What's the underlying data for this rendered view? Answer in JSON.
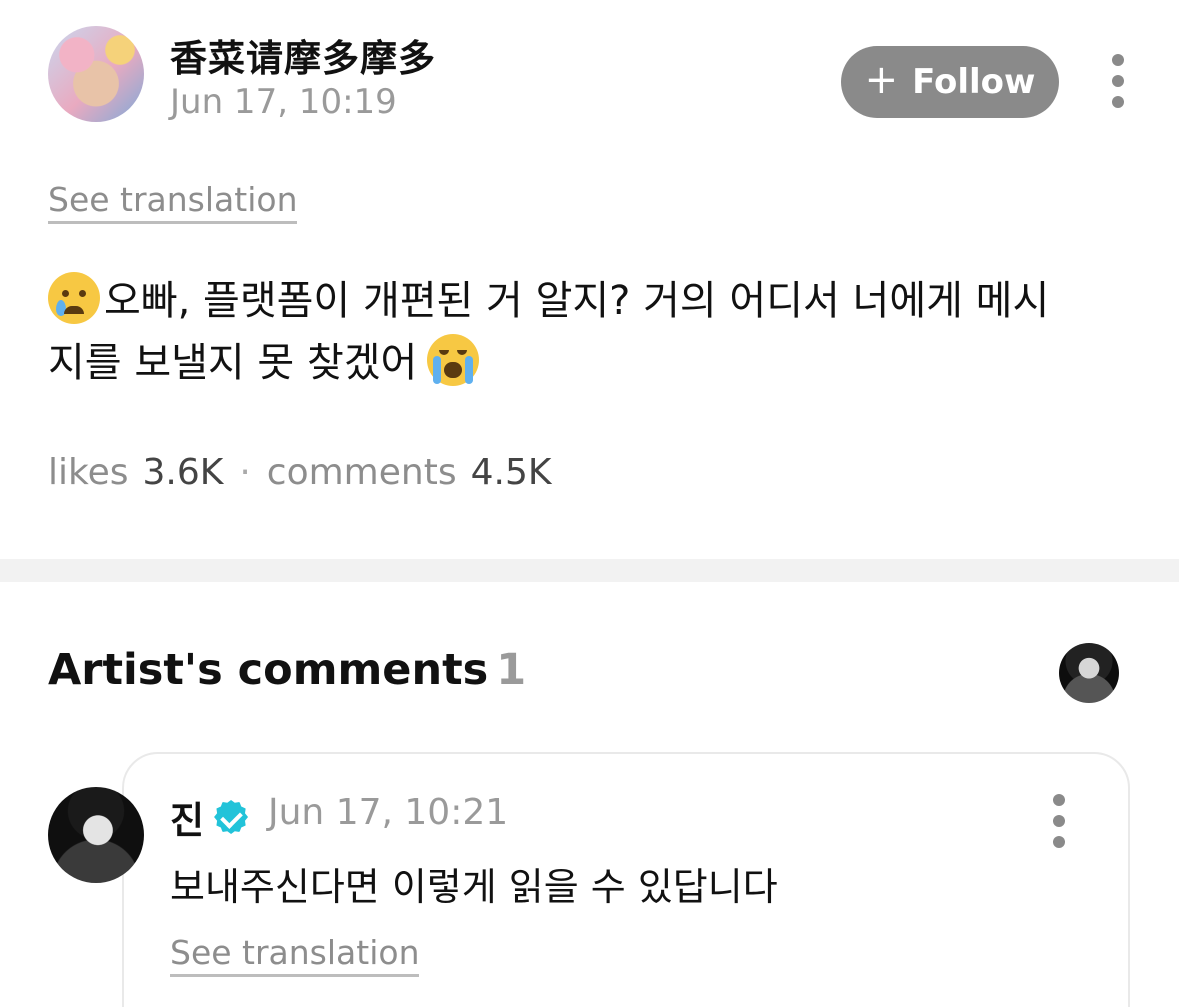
{
  "post": {
    "author": "香菜请摩多摩多",
    "date": "Jun 17, 10:19",
    "follow_label": "Follow",
    "see_translation": "See translation",
    "body_line1": "오빠, 플랫폼이 개편된 거 알지? 거의 어디서 너에게 메시",
    "body_line2": "지를 보낼지 못 찾겠어",
    "emoji_start": "crying-face",
    "emoji_end": "loudly-crying-face",
    "likes_label": "likes",
    "likes_value": "3.6K",
    "separator": "·",
    "comments_label": "comments",
    "comments_value": "4.5K"
  },
  "artist_comments": {
    "title": "Artist's comments",
    "count": "1",
    "comment": {
      "author": "진",
      "verified": true,
      "date": "Jun 17, 10:21",
      "body": "보내주신다면 이렇게 읽을 수 있답니다",
      "see_translation": "See translation"
    }
  },
  "colors": {
    "follow_bg": "#8a8a8a",
    "verified": "#22c3d9",
    "muted_text": "#9a9a9a",
    "divider": "#f2f2f2"
  }
}
